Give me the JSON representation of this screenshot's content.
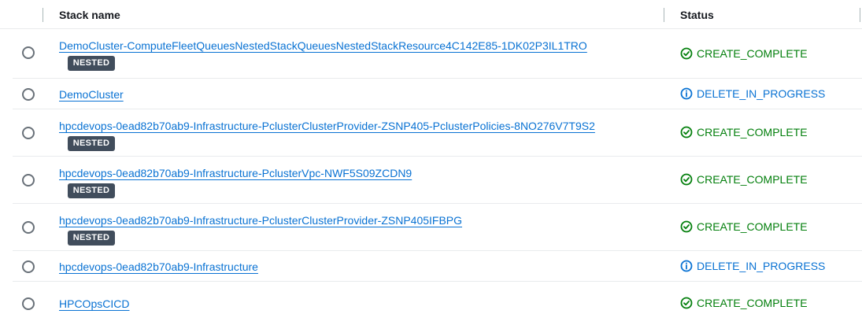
{
  "table": {
    "columns": {
      "stack_name": "Stack name",
      "status": "Status"
    },
    "badge_label": "NESTED",
    "rows": [
      {
        "name": "DemoCluster-ComputeFleetQueuesNestedStackQueuesNestedStackResource4C142E85-1DK02P3IL1TRO",
        "nested": true,
        "status": "CREATE_COMPLETE",
        "status_kind": "success"
      },
      {
        "name": "DemoCluster",
        "nested": false,
        "status": "DELETE_IN_PROGRESS",
        "status_kind": "info"
      },
      {
        "name": "hpcdevops-0ead82b70ab9-Infrastructure-PclusterClusterProvider-ZSNP405-PclusterPolicies-8NO276V7T9S2",
        "nested": true,
        "status": "CREATE_COMPLETE",
        "status_kind": "success"
      },
      {
        "name": "hpcdevops-0ead82b70ab9-Infrastructure-PclusterVpc-NWF5S09ZCDN9",
        "nested": true,
        "status": "CREATE_COMPLETE",
        "status_kind": "success"
      },
      {
        "name": "hpcdevops-0ead82b70ab9-Infrastructure-PclusterClusterProvider-ZSNP405IFBPG",
        "nested": true,
        "status": "CREATE_COMPLETE",
        "status_kind": "success"
      },
      {
        "name": "hpcdevops-0ead82b70ab9-Infrastructure",
        "nested": false,
        "status": "DELETE_IN_PROGRESS",
        "status_kind": "info"
      },
      {
        "name": "HPCOpsCICD",
        "nested": false,
        "status": "CREATE_COMPLETE",
        "status_kind": "success"
      }
    ]
  },
  "colors": {
    "link": "#0972d3",
    "success": "#037f0c",
    "info": "#0972d3",
    "badge_bg": "#414d5c"
  },
  "icons": {
    "success": "check-circle-icon",
    "info": "info-circle-icon"
  }
}
